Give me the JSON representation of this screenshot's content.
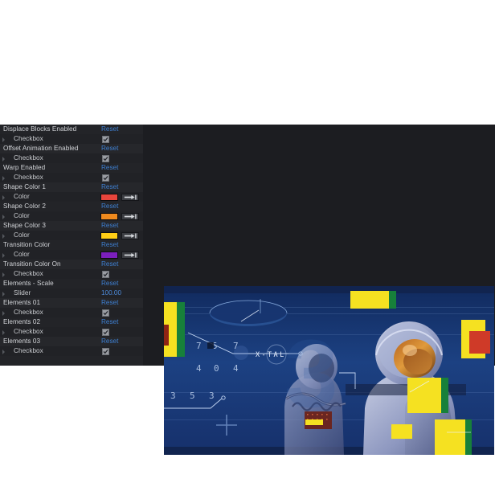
{
  "panel": {
    "name": "properties-panel",
    "reset_label": "Reset",
    "rows": [
      {
        "label": "Displace Blocks Enabled",
        "control": "checkbox",
        "control_label": "Checkbox",
        "checked": true
      },
      {
        "label": "Offset Animation Enabled",
        "control": "checkbox",
        "control_label": "Checkbox",
        "checked": true
      },
      {
        "label": "Warp Enabled",
        "control": "checkbox",
        "control_label": "Checkbox",
        "checked": true
      },
      {
        "label": "Shape Color 1",
        "control": "color",
        "control_label": "Color",
        "color": "#e8453c"
      },
      {
        "label": "Shape Color 2",
        "control": "color",
        "control_label": "Color",
        "color": "#ef8a1e"
      },
      {
        "label": "Shape Color 3",
        "control": "color",
        "control_label": "Color",
        "color": "#ffce16"
      },
      {
        "label": "Transition Color",
        "control": "color",
        "control_label": "Color",
        "color": "#7b1fbd"
      },
      {
        "label": "Transition Color On",
        "control": "checkbox",
        "control_label": "Checkbox",
        "checked": true
      },
      {
        "label": "Elements - Scale",
        "control": "slider",
        "control_label": "Slider",
        "value": "100.00"
      },
      {
        "label": "Elements 01",
        "control": "checkbox",
        "control_label": "Checkbox",
        "checked": true
      },
      {
        "label": "Elements 02",
        "control": "checkbox",
        "control_label": "Checkbox",
        "checked": true
      },
      {
        "label": "Elements 03",
        "control": "checkbox",
        "control_label": "Checkbox",
        "checked": true
      }
    ]
  },
  "preview": {
    "name": "preview-viewport",
    "hud_label": "X-TAL",
    "hud_numbers_row1": [
      "7",
      "5",
      "7"
    ],
    "hud_numbers_row2": [
      "4",
      "0",
      "4"
    ],
    "hud_numbers_row3": [
      "3",
      "5",
      "3"
    ],
    "accent_yellow": "#f5e121",
    "accent_green": "#17803a",
    "accent_red": "#cf3a28",
    "accent_dark_red": "#8f2414",
    "background_blue": "#1b3d7d"
  },
  "colors": {
    "canvas_bg": "#1c1d21",
    "panel_bg": "#232428",
    "reset_link": "#3e7fd1",
    "label_text": "#d2d4d8",
    "page_bg": "#ffffff"
  }
}
